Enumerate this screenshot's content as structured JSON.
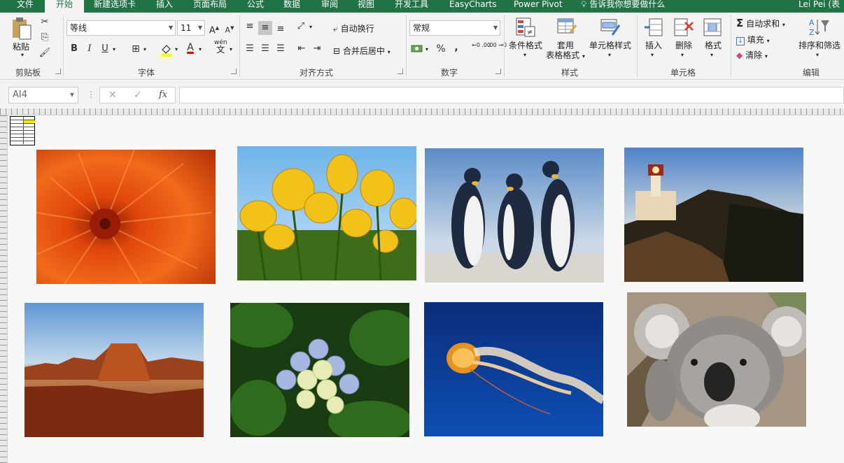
{
  "tabs": [
    "文件",
    "开始",
    "新建选项卡",
    "插入",
    "页面布局",
    "公式",
    "数据",
    "审阅",
    "视图",
    "开发工具",
    "EasyCharts",
    "Power Pivot"
  ],
  "tell_me": "告诉我你想要做什么",
  "user": "Lei Pei (表",
  "clipboard": {
    "paste": "粘贴",
    "label": "剪贴板"
  },
  "font": {
    "name": "等线",
    "size": "11",
    "label": "字体",
    "bold": "B",
    "italic": "I",
    "underline": "U",
    "font_color_glyph": "A",
    "phonetic": "wén",
    "phonetic_sub": "文",
    "grow": "A",
    "shrink": "A"
  },
  "alignment": {
    "wrap": "自动换行",
    "merge": "合并后居中",
    "label": "对齐方式"
  },
  "number": {
    "format": "常规",
    "label": "数字",
    "percent": "%",
    "comma": ",",
    "inc": "←0 .00",
    "dec": ".00 →0"
  },
  "styles": {
    "conditional": "条件格式",
    "table_line1": "套用",
    "table_line2": "表格格式",
    "cell_styles": "单元格样式",
    "label": "样式"
  },
  "cells": {
    "insert": "插入",
    "delete": "删除",
    "format": "格式",
    "label": "单元格"
  },
  "editing": {
    "autosum": "自动求和",
    "fill": "填充",
    "clear": "清除",
    "sort": "排序和筛选",
    "label": "编辑"
  },
  "formula_bar": {
    "namebox": "AI4",
    "fx": "fx",
    "cancel": "✕",
    "enter": "✓"
  },
  "pictures": [
    "chrysanthemum",
    "tulips",
    "penguins",
    "lighthouse",
    "desert",
    "hydrangeas",
    "jellyfish",
    "koala"
  ],
  "colors": {
    "ribbon_green": "#217346",
    "ribbon_bg": "#f3f3f3",
    "sheet_bg": "#f8f8f8"
  }
}
